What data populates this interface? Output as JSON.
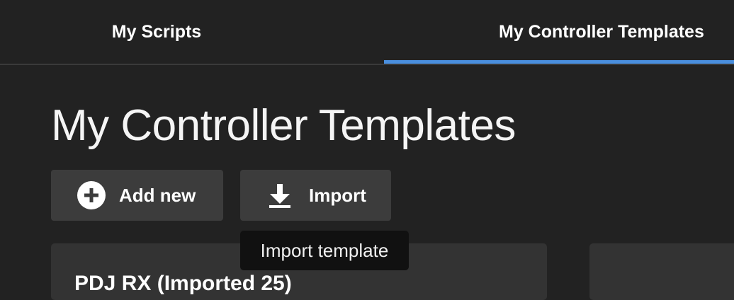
{
  "tabs": [
    {
      "label": "My Scripts",
      "active": false
    },
    {
      "label": "My Controller Templates",
      "active": true
    }
  ],
  "colors": {
    "background": "#222222",
    "button": "#3c3c3c",
    "card": "#333333",
    "accent": "#4a8fde",
    "tooltip": "#111111"
  },
  "page": {
    "title": "My Controller Templates"
  },
  "actions": {
    "add_new": {
      "label": "Add new",
      "icon": "plus-circle-icon"
    },
    "import": {
      "label": "Import",
      "icon": "download-icon"
    }
  },
  "tooltip": {
    "text": "Import template"
  },
  "cards": [
    {
      "title": "PDJ RX (Imported 25)"
    },
    {
      "title": ""
    }
  ]
}
